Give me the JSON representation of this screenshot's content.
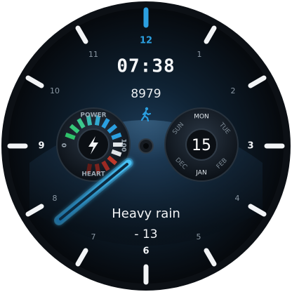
{
  "face": {
    "time": "07:38",
    "steps": "8979",
    "weather": "Heavy rain",
    "temperature": "- 13",
    "colors": {
      "accent": "#2b9fe0",
      "hand_glow": "#3fb8f0",
      "bezel": "#0c1015"
    },
    "icons": {
      "steps": "walking-person-icon",
      "power": "lightning-bolt-icon"
    }
  },
  "dial": {
    "hours": {
      "h12": "12",
      "h1": "1",
      "h2": "2",
      "h3": "3",
      "h4": "4",
      "h5": "5",
      "h6": "6",
      "h7": "7",
      "h8": "8",
      "h9": "9",
      "h10": "10",
      "h11": "11"
    }
  },
  "power_gauge": {
    "title": "POWER",
    "bottom_label": "HEART",
    "min_label": "0",
    "max_label": "100"
  },
  "date_dial": {
    "date": "15",
    "days": {
      "sun": "SUN",
      "mon": "MON",
      "tue": "TUE"
    },
    "months": {
      "dec": "DEC",
      "jan": "JAN",
      "feb": "FEB"
    }
  }
}
